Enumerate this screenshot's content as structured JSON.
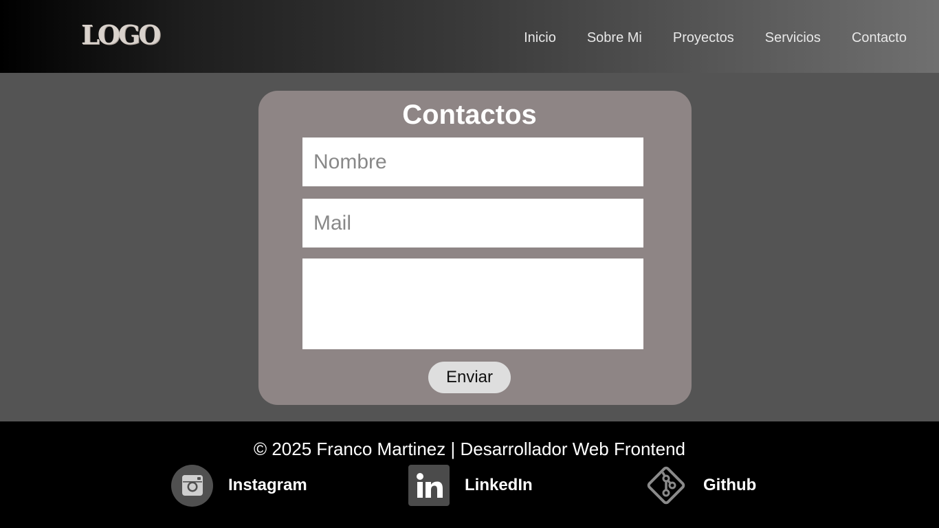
{
  "header": {
    "logo_text": "LOGO",
    "nav": [
      "Inicio",
      "Sobre Mi",
      "Proyectos",
      "Servicios",
      "Contacto"
    ]
  },
  "contact": {
    "title": "Contactos",
    "name_placeholder": "Nombre",
    "mail_placeholder": "Mail",
    "message_placeholder": "",
    "send_label": "Enviar"
  },
  "footer": {
    "copyright": "© 2025 Franco Martinez | Desarrollador Web Frontend",
    "social": [
      {
        "label": "Instagram",
        "icon": "instagram-icon"
      },
      {
        "label": "LinkedIn",
        "icon": "linkedin-icon"
      },
      {
        "label": "Github",
        "icon": "git-icon"
      }
    ]
  },
  "colors": {
    "card": "#8e8585",
    "page": "#545454",
    "footer": "#000000",
    "button": "#dedede"
  }
}
